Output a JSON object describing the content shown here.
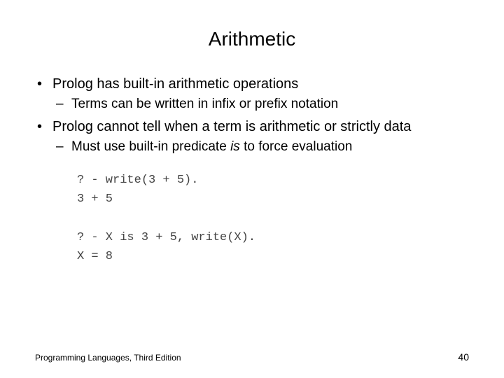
{
  "title": "Arithmetic",
  "bullets": {
    "b1": "Prolog has built-in arithmetic operations",
    "b1a": "Terms can be written in infix or prefix notation",
    "b2": "Prolog cannot tell when a term is arithmetic or strictly data",
    "b2a_pre": "Must use built-in predicate ",
    "b2a_em": "is",
    "b2a_post": " to force evaluation"
  },
  "code": "? - write(3 + 5).\n3 + 5\n\n? - X is 3 + 5, write(X).\nX = 8",
  "footer": {
    "left": "Programming Languages, Third Edition",
    "page": "40"
  }
}
